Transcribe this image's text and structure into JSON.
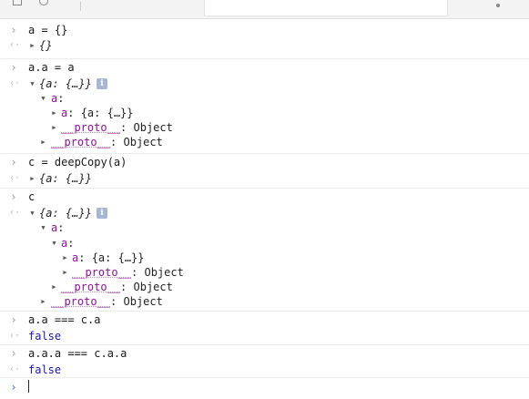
{
  "toolbar": {
    "icons": [
      "panel-icon",
      "clear-console-icon"
    ],
    "filter": {
      "placeholder": ""
    }
  },
  "console": {
    "entries": [
      {
        "kind": "input",
        "text": "a = {}"
      },
      {
        "kind": "result",
        "preview": "{}"
      },
      {
        "kind": "input",
        "text": "a.a = a"
      },
      {
        "kind": "result",
        "preview": "{a: {…}}",
        "badge": "i",
        "tree": [
          {
            "key": "a",
            "sep": ":",
            "value": ""
          },
          {
            "key": "a",
            "sep": ":",
            "value": " {a: {…}}"
          },
          {
            "key": "__proto__",
            "sep": ":",
            "value": " Object"
          },
          {
            "key": "__proto__",
            "sep": ":",
            "value": " Object"
          }
        ]
      },
      {
        "kind": "input",
        "text": "c = deepCopy(a)"
      },
      {
        "kind": "result",
        "preview": "{a: {…}}"
      },
      {
        "kind": "input",
        "text": "c"
      },
      {
        "kind": "result",
        "preview": "{a: {…}}",
        "badge": "i",
        "tree": [
          {
            "key": "a",
            "sep": ":",
            "value": ""
          },
          {
            "key": "a",
            "sep": ":",
            "value": ""
          },
          {
            "key": "a",
            "sep": ":",
            "value": " {a: {…}}"
          },
          {
            "key": "__proto__",
            "sep": ":",
            "value": " Object"
          },
          {
            "key": "__proto__",
            "sep": ":",
            "value": " Object"
          },
          {
            "key": "__proto__",
            "sep": ":",
            "value": " Object"
          }
        ]
      },
      {
        "kind": "input",
        "text": "a.a === c.a"
      },
      {
        "kind": "result",
        "text": "false"
      },
      {
        "kind": "input",
        "text": "a.a.a === c.a.a"
      },
      {
        "kind": "result",
        "text": "false"
      }
    ],
    "prompt": {
      "value": ""
    }
  },
  "icons": {
    "input_prompt": "›",
    "result_marker": "‹·",
    "expanded": "▼",
    "collapsed": "▶"
  },
  "colors": {
    "property_key": "#881391",
    "boolean": "#1a1aa6",
    "prompt_active": "#2f6ee6",
    "info_badge": "#a7b7d2"
  }
}
